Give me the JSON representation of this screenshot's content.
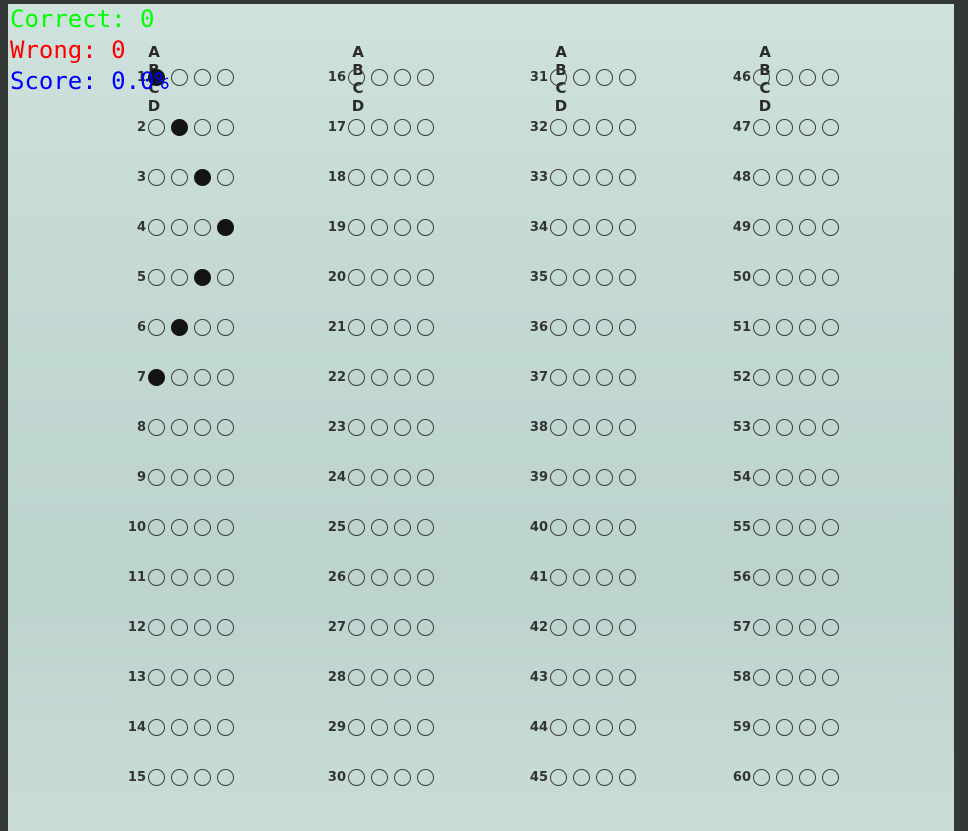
{
  "overlay": {
    "correct": "Correct: 0",
    "wrong": "Wrong: 0",
    "score": "Score: 0.0%",
    "colors": {
      "correct": "#00ff00",
      "wrong": "#ff0000",
      "score": "#0000ff"
    }
  },
  "sheet": {
    "options": [
      "A",
      "B",
      "C",
      "D"
    ],
    "columns": [
      {
        "questions": [
          1,
          2,
          3,
          4,
          5,
          6,
          7,
          8,
          9,
          10,
          11,
          12,
          13,
          14,
          15
        ]
      },
      {
        "questions": [
          16,
          17,
          18,
          19,
          20,
          21,
          22,
          23,
          24,
          25,
          26,
          27,
          28,
          29,
          30
        ]
      },
      {
        "questions": [
          31,
          32,
          33,
          34,
          35,
          36,
          37,
          38,
          39,
          40,
          41,
          42,
          43,
          44,
          45
        ]
      },
      {
        "questions": [
          46,
          47,
          48,
          49,
          50,
          51,
          52,
          53,
          54,
          55,
          56,
          57,
          58,
          59,
          60
        ]
      }
    ],
    "marked_answers": {
      "1": "A",
      "2": "B",
      "3": "C",
      "4": "D",
      "5": "C",
      "6": "B",
      "7": "A"
    }
  }
}
